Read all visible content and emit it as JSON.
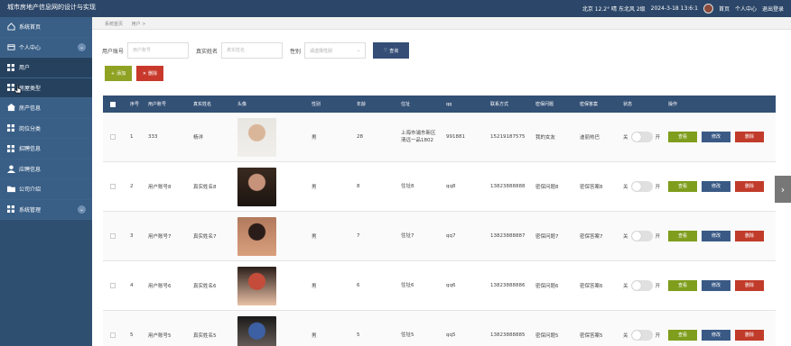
{
  "header": {
    "app_title": "城市房地产信息网的设计与实现",
    "weather": "北京 12.2° 晴 东北风 2级",
    "datetime": "2024-3-18 13:6:1",
    "links": [
      "首页",
      "个人中心",
      "退出登录"
    ]
  },
  "sidebar": {
    "items": [
      {
        "label": "系统首页",
        "icon": "home-icon",
        "type": "top"
      },
      {
        "label": "个人中心",
        "icon": "profile-icon",
        "type": "top",
        "expandable": true
      },
      {
        "label": "用户",
        "icon": "grid-icon",
        "type": "sub"
      },
      {
        "label": "房屋类型",
        "icon": "grid-icon",
        "type": "sub"
      },
      {
        "label": "房产信息",
        "icon": "house-icon",
        "type": "top"
      },
      {
        "label": "岗位分类",
        "icon": "grid-icon",
        "type": "top"
      },
      {
        "label": "招聘信息",
        "icon": "grid-icon",
        "type": "top"
      },
      {
        "label": "应聘信息",
        "icon": "user-icon",
        "type": "top"
      },
      {
        "label": "公司介绍",
        "icon": "folder-icon",
        "type": "top"
      },
      {
        "label": "系统管理",
        "icon": "grid-icon",
        "type": "top",
        "expandable": true
      }
    ]
  },
  "breadcrumb": [
    "系统首页",
    "用户 >"
  ],
  "search": {
    "account_label": "用户账号",
    "account_placeholder": "用户账号",
    "name_label": "真实姓名",
    "name_placeholder": "真实姓名",
    "gender_label": "性别",
    "gender_placeholder": "请选择性别",
    "query_button": "查询"
  },
  "actions": {
    "add": "添加",
    "delete": "删除"
  },
  "table": {
    "columns": [
      "序号",
      "用户账号",
      "真实姓名",
      "头像",
      "性别",
      "年龄",
      "住址",
      "qq",
      "联系方式",
      "密保问题",
      "密保答案",
      "状态",
      "操作"
    ],
    "toggle_off": "关",
    "toggle_on": "开",
    "btn_view": "查看",
    "btn_edit": "修改",
    "btn_delete": "删除",
    "rows": [
      {
        "no": "1",
        "account": "333",
        "name": "杨洋",
        "gender": "男",
        "age": "28",
        "address_line1": "上海市浦东新区",
        "address_line2": "清远一品1802",
        "qq": "991881",
        "phone": "15219187575",
        "question": "我的女友",
        "answer": "迪丽热巴",
        "photo_colors": [
          "#e8e6e1",
          "#f1efeb",
          "#d9b69a"
        ]
      },
      {
        "no": "2",
        "account": "用户账号8",
        "name": "真实姓名8",
        "gender": "男",
        "age": "8",
        "address_line1": "住址8",
        "address_line2": "",
        "qq": "qq8",
        "phone": "13823888888",
        "question": "密保问题8",
        "answer": "密保答案8",
        "photo_colors": [
          "#3a2a1f",
          "#1c1511",
          "#c7927a"
        ]
      },
      {
        "no": "3",
        "account": "用户账号7",
        "name": "真实姓名7",
        "gender": "男",
        "age": "7",
        "address_line1": "住址7",
        "address_line2": "",
        "qq": "qq7",
        "phone": "13823888887",
        "question": "密保问题7",
        "answer": "密保答案7",
        "photo_colors": [
          "#b27a5d",
          "#d9a07d",
          "#2a1c18"
        ]
      },
      {
        "no": "4",
        "account": "用户账号6",
        "name": "真实姓名6",
        "gender": "男",
        "age": "6",
        "address_line1": "住址6",
        "address_line2": "",
        "qq": "qq6",
        "phone": "13823888886",
        "question": "密保问题6",
        "answer": "密保答案6",
        "photo_colors": [
          "#2b1e1a",
          "#e8c0a6",
          "#c54c3a"
        ]
      },
      {
        "no": "5",
        "account": "用户账号5",
        "name": "真实姓名5",
        "gender": "男",
        "age": "5",
        "address_line1": "住址5",
        "address_line2": "",
        "qq": "qq5",
        "phone": "13823888885",
        "question": "密保问题5",
        "answer": "密保答案5",
        "photo_colors": [
          "#1a1a1a",
          "#7b6f68",
          "#3d5fa3"
        ]
      }
    ]
  },
  "colors": {
    "topbar": "#2b4668",
    "sidebar": "#2e4f70",
    "table_header": "#335075",
    "add": "#8fa223",
    "delete": "#c8392c",
    "query": "#344e76"
  }
}
